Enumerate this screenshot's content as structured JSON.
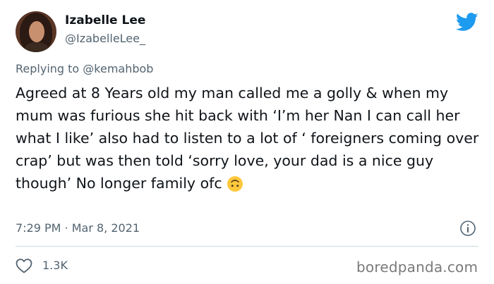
{
  "user": {
    "display_name": "Izabelle Lee",
    "handle": "@IzabelleLee_"
  },
  "reply": {
    "text": "Replying to @kemahbob"
  },
  "tweet": {
    "text": "Agreed at 8 Years old my man called me a golly & when my mum was furious she hit back with ‘I’m her Nan I can call her what I like’ also had to listen to a lot of ‘ foreigners coming over crap’ but was then told ‘sorry love, your dad is a nice guy though’ No longer family ofc",
    "emoji": "upside-down-face-emoji",
    "timestamp": "7:29 PM · Mar 8, 2021"
  },
  "stats": {
    "likes": "1.3K"
  },
  "watermark": "boredpanda.com",
  "icons": {
    "logo": "twitter-bird-icon",
    "info": "info-icon",
    "like": "heart-icon"
  },
  "colors": {
    "twitter_blue": "#1d9bf0",
    "text_primary": "#0f1419",
    "text_secondary": "#536471",
    "divider": "#cfd9de",
    "emoji_yellow": "#ffc83d"
  }
}
